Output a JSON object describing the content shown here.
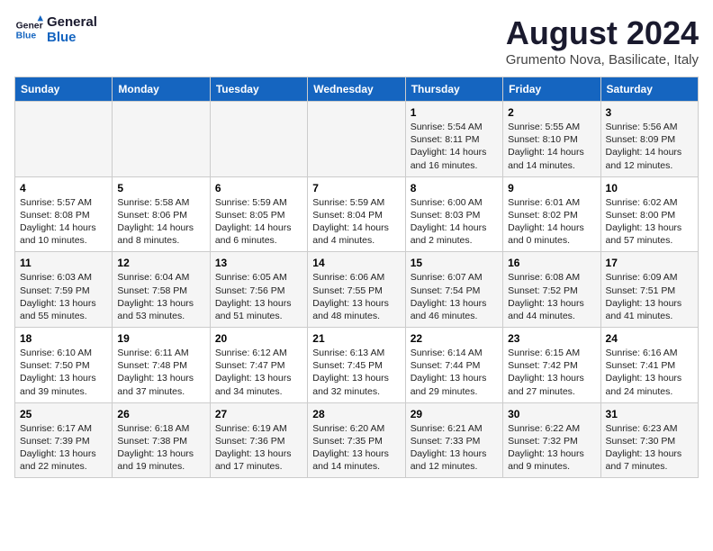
{
  "header": {
    "logo_line1": "General",
    "logo_line2": "Blue",
    "month": "August 2024",
    "location": "Grumento Nova, Basilicate, Italy"
  },
  "days_of_week": [
    "Sunday",
    "Monday",
    "Tuesday",
    "Wednesday",
    "Thursday",
    "Friday",
    "Saturday"
  ],
  "weeks": [
    [
      {
        "day": "",
        "info": ""
      },
      {
        "day": "",
        "info": ""
      },
      {
        "day": "",
        "info": ""
      },
      {
        "day": "",
        "info": ""
      },
      {
        "day": "1",
        "info": "Sunrise: 5:54 AM\nSunset: 8:11 PM\nDaylight: 14 hours\nand 16 minutes."
      },
      {
        "day": "2",
        "info": "Sunrise: 5:55 AM\nSunset: 8:10 PM\nDaylight: 14 hours\nand 14 minutes."
      },
      {
        "day": "3",
        "info": "Sunrise: 5:56 AM\nSunset: 8:09 PM\nDaylight: 14 hours\nand 12 minutes."
      }
    ],
    [
      {
        "day": "4",
        "info": "Sunrise: 5:57 AM\nSunset: 8:08 PM\nDaylight: 14 hours\nand 10 minutes."
      },
      {
        "day": "5",
        "info": "Sunrise: 5:58 AM\nSunset: 8:06 PM\nDaylight: 14 hours\nand 8 minutes."
      },
      {
        "day": "6",
        "info": "Sunrise: 5:59 AM\nSunset: 8:05 PM\nDaylight: 14 hours\nand 6 minutes."
      },
      {
        "day": "7",
        "info": "Sunrise: 5:59 AM\nSunset: 8:04 PM\nDaylight: 14 hours\nand 4 minutes."
      },
      {
        "day": "8",
        "info": "Sunrise: 6:00 AM\nSunset: 8:03 PM\nDaylight: 14 hours\nand 2 minutes."
      },
      {
        "day": "9",
        "info": "Sunrise: 6:01 AM\nSunset: 8:02 PM\nDaylight: 14 hours\nand 0 minutes."
      },
      {
        "day": "10",
        "info": "Sunrise: 6:02 AM\nSunset: 8:00 PM\nDaylight: 13 hours\nand 57 minutes."
      }
    ],
    [
      {
        "day": "11",
        "info": "Sunrise: 6:03 AM\nSunset: 7:59 PM\nDaylight: 13 hours\nand 55 minutes."
      },
      {
        "day": "12",
        "info": "Sunrise: 6:04 AM\nSunset: 7:58 PM\nDaylight: 13 hours\nand 53 minutes."
      },
      {
        "day": "13",
        "info": "Sunrise: 6:05 AM\nSunset: 7:56 PM\nDaylight: 13 hours\nand 51 minutes."
      },
      {
        "day": "14",
        "info": "Sunrise: 6:06 AM\nSunset: 7:55 PM\nDaylight: 13 hours\nand 48 minutes."
      },
      {
        "day": "15",
        "info": "Sunrise: 6:07 AM\nSunset: 7:54 PM\nDaylight: 13 hours\nand 46 minutes."
      },
      {
        "day": "16",
        "info": "Sunrise: 6:08 AM\nSunset: 7:52 PM\nDaylight: 13 hours\nand 44 minutes."
      },
      {
        "day": "17",
        "info": "Sunrise: 6:09 AM\nSunset: 7:51 PM\nDaylight: 13 hours\nand 41 minutes."
      }
    ],
    [
      {
        "day": "18",
        "info": "Sunrise: 6:10 AM\nSunset: 7:50 PM\nDaylight: 13 hours\nand 39 minutes."
      },
      {
        "day": "19",
        "info": "Sunrise: 6:11 AM\nSunset: 7:48 PM\nDaylight: 13 hours\nand 37 minutes."
      },
      {
        "day": "20",
        "info": "Sunrise: 6:12 AM\nSunset: 7:47 PM\nDaylight: 13 hours\nand 34 minutes."
      },
      {
        "day": "21",
        "info": "Sunrise: 6:13 AM\nSunset: 7:45 PM\nDaylight: 13 hours\nand 32 minutes."
      },
      {
        "day": "22",
        "info": "Sunrise: 6:14 AM\nSunset: 7:44 PM\nDaylight: 13 hours\nand 29 minutes."
      },
      {
        "day": "23",
        "info": "Sunrise: 6:15 AM\nSunset: 7:42 PM\nDaylight: 13 hours\nand 27 minutes."
      },
      {
        "day": "24",
        "info": "Sunrise: 6:16 AM\nSunset: 7:41 PM\nDaylight: 13 hours\nand 24 minutes."
      }
    ],
    [
      {
        "day": "25",
        "info": "Sunrise: 6:17 AM\nSunset: 7:39 PM\nDaylight: 13 hours\nand 22 minutes."
      },
      {
        "day": "26",
        "info": "Sunrise: 6:18 AM\nSunset: 7:38 PM\nDaylight: 13 hours\nand 19 minutes."
      },
      {
        "day": "27",
        "info": "Sunrise: 6:19 AM\nSunset: 7:36 PM\nDaylight: 13 hours\nand 17 minutes."
      },
      {
        "day": "28",
        "info": "Sunrise: 6:20 AM\nSunset: 7:35 PM\nDaylight: 13 hours\nand 14 minutes."
      },
      {
        "day": "29",
        "info": "Sunrise: 6:21 AM\nSunset: 7:33 PM\nDaylight: 13 hours\nand 12 minutes."
      },
      {
        "day": "30",
        "info": "Sunrise: 6:22 AM\nSunset: 7:32 PM\nDaylight: 13 hours\nand 9 minutes."
      },
      {
        "day": "31",
        "info": "Sunrise: 6:23 AM\nSunset: 7:30 PM\nDaylight: 13 hours\nand 7 minutes."
      }
    ]
  ]
}
